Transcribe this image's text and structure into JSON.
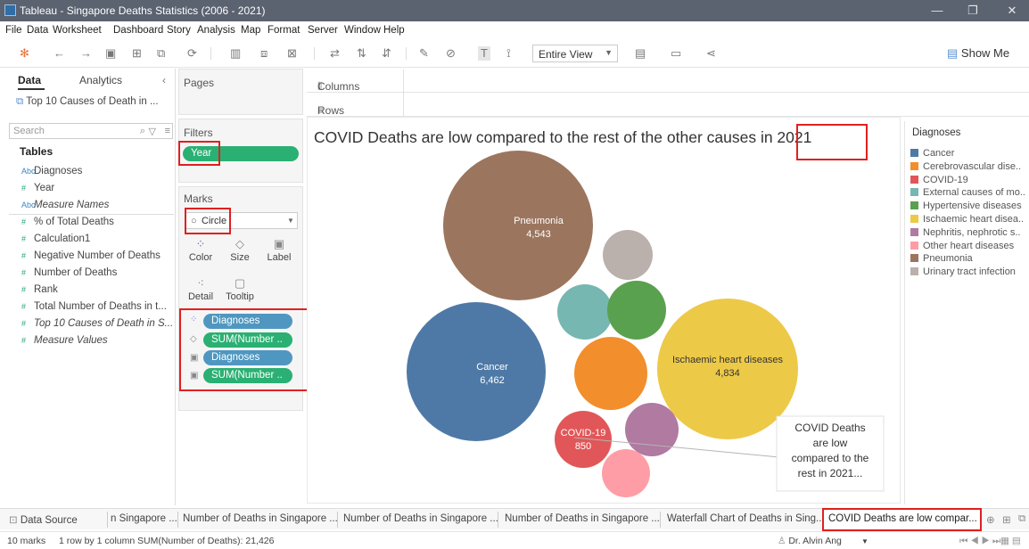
{
  "window": {
    "title": "Tableau - Singapore Deaths Statistics (2006 - 2021)"
  },
  "menu": [
    "File",
    "Data",
    "Worksheet",
    "Dashboard",
    "Story",
    "Analysis",
    "Map",
    "Format",
    "Server",
    "Window",
    "Help"
  ],
  "toolbar": {
    "view_select": "Entire View",
    "show_me": "Show Me"
  },
  "data_pane": {
    "tab_data": "Data",
    "tab_analytics": "Analytics",
    "source": "Top 10 Causes of Death in ...",
    "search_placeholder": "Search",
    "tables_header": "Tables",
    "fields": [
      {
        "label": "Diagnoses",
        "type": "Abc"
      },
      {
        "label": "Year",
        "type": "#"
      },
      {
        "label": "Measure Names",
        "type": "Abc"
      },
      {
        "label": "% of Total Deaths",
        "type": "#"
      },
      {
        "label": "Calculation1",
        "type": "#"
      },
      {
        "label": "Negative Number of Deaths",
        "type": "#"
      },
      {
        "label": "Number of Deaths",
        "type": "#"
      },
      {
        "label": "Rank",
        "type": "#"
      },
      {
        "label": "Total Number of Deaths in t...",
        "type": "#"
      },
      {
        "label": "Top 10 Causes of Death in S...",
        "type": "#"
      },
      {
        "label": "Measure Values",
        "type": "#"
      }
    ]
  },
  "shelves": {
    "pages": "Pages",
    "filters": "Filters",
    "filter_pill": "Year",
    "marks": "Marks",
    "mark_type": "Circle",
    "mark_buttons": [
      "Color",
      "Size",
      "Label",
      "Detail",
      "Tooltip"
    ],
    "mark_pills": [
      "Diagnoses",
      "SUM(Number ..",
      "Diagnoses",
      "SUM(Number .."
    ],
    "columns": "Columns",
    "rows": "Rows"
  },
  "viz": {
    "title": "COVID Deaths are low compared to the rest of the other causes in 2021",
    "annotation": [
      "COVID Deaths",
      "are low",
      "compared to the",
      "rest in 2021..."
    ],
    "colors": {
      "Cancer": "#4e79a7",
      "Cerebrovascular": "#f28e2b",
      "COVID-19": "#e15759",
      "External": "#76b7b2",
      "Hypertensive": "#59a14f",
      "Ischaemic": "#edc948",
      "Nephritis": "#b07aa1",
      "Other heart": "#ff9da7",
      "Pneumonia": "#9c755f",
      "Urinary": "#bab0ac"
    }
  },
  "chart_data": {
    "type": "bubble",
    "title": "COVID Deaths are low compared to the rest of the other causes in 2021",
    "labeled": [
      {
        "name": "Pneumonia",
        "value": 4543
      },
      {
        "name": "Cancer",
        "value": 6462
      },
      {
        "name": "Ischaemic heart diseases",
        "value": 4834
      },
      {
        "name": "COVID-19",
        "value": 850
      }
    ]
  },
  "legend": {
    "title": "Diagnoses",
    "items": [
      {
        "label": "Cancer",
        "color": "#4e79a7"
      },
      {
        "label": "Cerebrovascular  dise..",
        "color": "#f28e2b"
      },
      {
        "label": "COVID-19",
        "color": "#e15759"
      },
      {
        "label": "External causes of mo..",
        "color": "#76b7b2"
      },
      {
        "label": "Hypertensive diseases",
        "color": "#59a14f"
      },
      {
        "label": "Ischaemic heart disea..",
        "color": "#edc948"
      },
      {
        "label": "Nephritis, nephrotic s..",
        "color": "#b07aa1"
      },
      {
        "label": "Other heart diseases",
        "color": "#ff9da7"
      },
      {
        "label": "Pneumonia",
        "color": "#9c755f"
      },
      {
        "label": "Urinary tract infection",
        "color": "#bab0ac"
      }
    ]
  },
  "sheet_tabs": [
    "Data Source",
    "n Singapore ...",
    "Number of Deaths in Singapore ...",
    "Number of Deaths in Singapore ...",
    "Number of Deaths in Singapore ...",
    "Waterfall Chart of Deaths in Sing...",
    "COVID Deaths are low compar..."
  ],
  "status": {
    "marks": "10 marks",
    "dims": "1 row by 1 column",
    "sum": "SUM(Number of Deaths): 21,426",
    "user": "Dr. Alvin Ang"
  }
}
